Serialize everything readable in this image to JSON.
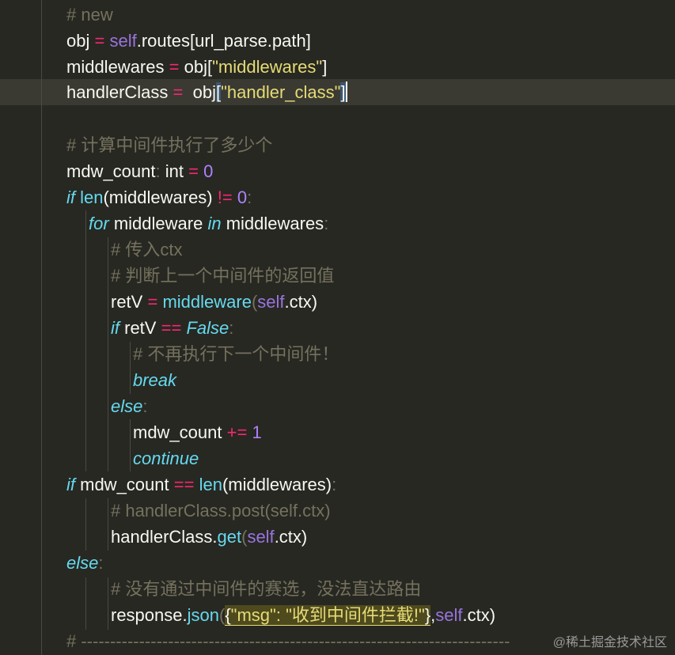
{
  "code": {
    "line01": {
      "comment": "# new"
    },
    "line02": {
      "a": "obj",
      "op": "=",
      "self": "self",
      "b": ".routes[url_parse.path]"
    },
    "line03": {
      "a": "middlewares",
      "op": "=",
      "b": "obj[",
      "str": "\"middlewares\"",
      "c": "]"
    },
    "line04": {
      "a": "handlerClass",
      "op": "=",
      "b": "obj",
      "br1": "[",
      "str": "\"handler_class\"",
      "br2": "]"
    },
    "line05": {
      "comment": "# 计算中间件执行了多少个"
    },
    "line06": {
      "a": "mdw_count",
      "colon": ":",
      "type": "int",
      "op": "=",
      "num": "0"
    },
    "line07": {
      "kw": "if",
      "fn": "len",
      "a": "(middlewares)",
      "op": "!=",
      "num": "0",
      "colon": ":"
    },
    "line08": {
      "kw": "for",
      "a": "middleware",
      "kw2": "in",
      "b": "middlewares",
      "colon": ":"
    },
    "line09": {
      "comment": "# 传入ctx"
    },
    "line10": {
      "comment": "# 判断上一个中间件的返回值"
    },
    "line11": {
      "a": "retV",
      "op": "=",
      "fn": "middleware",
      "p1": "(",
      "self": "self",
      "b": ".ctx)"
    },
    "line12": {
      "kw": "if",
      "a": "retV",
      "op": "==",
      "kw2": "False",
      "colon": ":"
    },
    "line13": {
      "comment": "# 不再执行下一个中间件！"
    },
    "line14": {
      "kw": "break"
    },
    "line15": {
      "kw": "else",
      "colon": ":"
    },
    "line16": {
      "a": "mdw_count",
      "op": "+=",
      "num": "1"
    },
    "line17": {
      "kw": "continue"
    },
    "line18": {
      "kw": "if",
      "a": "mdw_count",
      "op": "==",
      "fn": "len",
      "b": "(middlewares)",
      "colon": ":"
    },
    "line19": {
      "comment": "# handlerClass.post(self.ctx)"
    },
    "line20": {
      "a": "handlerClass.",
      "fn": "get",
      "p1": "(",
      "self": "self",
      "b": ".ctx)"
    },
    "line21": {
      "kw": "else",
      "colon": ":"
    },
    "line22": {
      "comment": "# 没有通过中间件的赛选，没法直达路由"
    },
    "line23": {
      "a": "response.",
      "fn": "json",
      "p1": "(",
      "br1": "{",
      "str": "\"msg\": \"收到中间件拦截!\"",
      "br2": "}",
      "comma": ",",
      "self": "self",
      "b": ".ctx)"
    },
    "line24": {
      "comment": "# ------------------------------------------------------------------------------"
    }
  },
  "watermark": "@稀土掘金技术社区"
}
